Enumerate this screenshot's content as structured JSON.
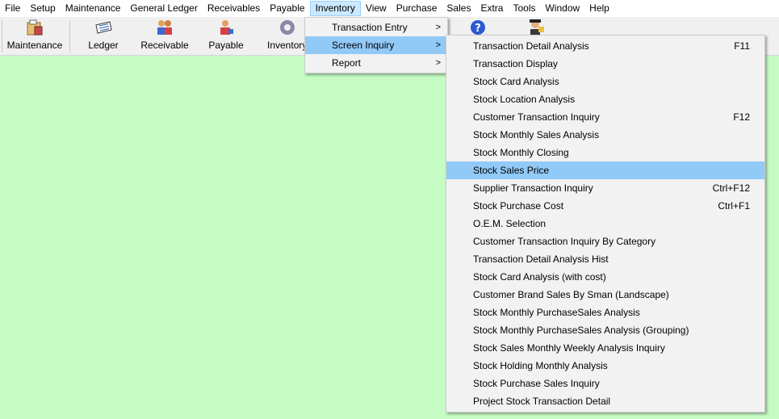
{
  "menubar": [
    "File",
    "Setup",
    "Maintenance",
    "General Ledger",
    "Receivables",
    "Payable",
    "Inventory",
    "View",
    "Purchase",
    "Sales",
    "Extra",
    "Tools",
    "Window",
    "Help"
  ],
  "toolbar": {
    "maintenance": "Maintenance",
    "ledger": "Ledger",
    "receivable": "Receivable",
    "payable": "Payable",
    "inventory": "Inventory"
  },
  "inventory_menu": [
    "Transaction Entry",
    "Screen Inquiry",
    "Report"
  ],
  "screen_inquiry_menu": [
    {
      "label": "Transaction Detail Analysis",
      "shortcut": "F11"
    },
    {
      "label": "Transaction Display",
      "shortcut": ""
    },
    {
      "label": "Stock Card Analysis",
      "shortcut": ""
    },
    {
      "label": "Stock Location Analysis",
      "shortcut": ""
    },
    {
      "label": "Customer Transaction Inquiry",
      "shortcut": "F12"
    },
    {
      "label": "Stock Monthly Sales Analysis",
      "shortcut": ""
    },
    {
      "label": "Stock Monthly Closing",
      "shortcut": ""
    },
    {
      "label": "Stock Sales Price",
      "shortcut": ""
    },
    {
      "label": "Supplier Transaction Inquiry",
      "shortcut": "Ctrl+F12"
    },
    {
      "label": "Stock Purchase Cost",
      "shortcut": "Ctrl+F1"
    },
    {
      "label": "O.E.M. Selection",
      "shortcut": ""
    },
    {
      "label": "Customer Transaction Inquiry By Category",
      "shortcut": ""
    },
    {
      "label": "Transaction Detail Analysis Hist",
      "shortcut": ""
    },
    {
      "label": "Stock Card Analysis (with cost)",
      "shortcut": ""
    },
    {
      "label": "Customer Brand Sales By Sman (Landscape)",
      "shortcut": ""
    },
    {
      "label": "Stock Monthly PurchaseSales Analysis",
      "shortcut": ""
    },
    {
      "label": "Stock Monthly PurchaseSales Analysis (Grouping)",
      "shortcut": ""
    },
    {
      "label": "Stock Sales Monthly Weekly Analysis Inquiry",
      "shortcut": ""
    },
    {
      "label": "Stock Holding Monthly Analysis",
      "shortcut": ""
    },
    {
      "label": "Stock Purchase Sales Inquiry",
      "shortcut": ""
    },
    {
      "label": "Project Stock Transaction Detail",
      "shortcut": ""
    }
  ],
  "colors": {
    "background": "#c4fcc4",
    "highlight": "#91c9f7",
    "menu_open": "#cce8ff"
  }
}
